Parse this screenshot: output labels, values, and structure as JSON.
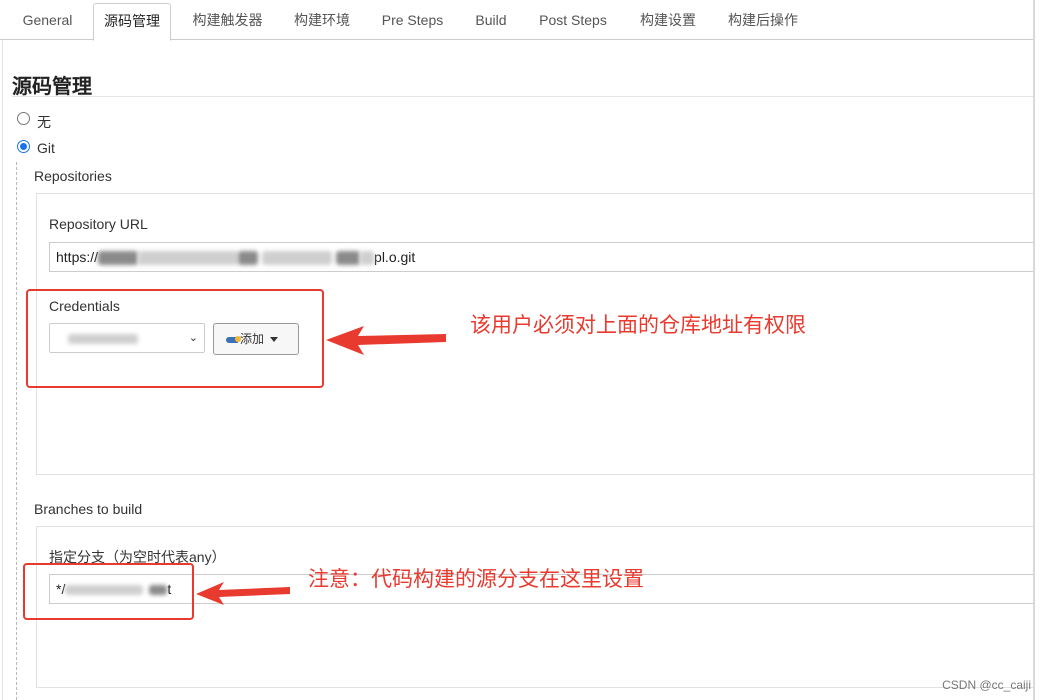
{
  "tabs": [
    {
      "label": "General",
      "active": false
    },
    {
      "label": "源码管理",
      "active": true
    },
    {
      "label": "构建触发器",
      "active": false
    },
    {
      "label": "构建环境",
      "active": false
    },
    {
      "label": "Pre Steps",
      "active": false
    },
    {
      "label": "Build",
      "active": false
    },
    {
      "label": "Post Steps",
      "active": false
    },
    {
      "label": "构建设置",
      "active": false
    },
    {
      "label": "构建后操作",
      "active": false
    }
  ],
  "scm": {
    "title": "源码管理",
    "options": [
      {
        "label": "无",
        "checked": false
      },
      {
        "label": "Git",
        "checked": true
      }
    ],
    "repositories_label": "Repositories",
    "repository_url_label": "Repository URL",
    "repository_url_prefix": "https://",
    "repository_url_suffix": "pl.o.git",
    "credentials_label": "Credentials",
    "credentials_add_button": "添加",
    "branches_label": "Branches to build",
    "branch_specifier_label": "指定分支（为空时代表any）",
    "branch_prefix": "*/",
    "branch_suffix": "t"
  },
  "annotations": {
    "credentials_note": "该用户必须对上面的仓库地址有权限",
    "branch_note": "注意：代码构建的源分支在这里设置",
    "color": "#e83a2e"
  },
  "watermark": "CSDN @cc_caiji",
  "icons": [
    "radio-unchecked-icon",
    "radio-checked-icon",
    "key-icon",
    "caret-down-icon",
    "chevron-down-icon",
    "arrow-left-icon"
  ]
}
